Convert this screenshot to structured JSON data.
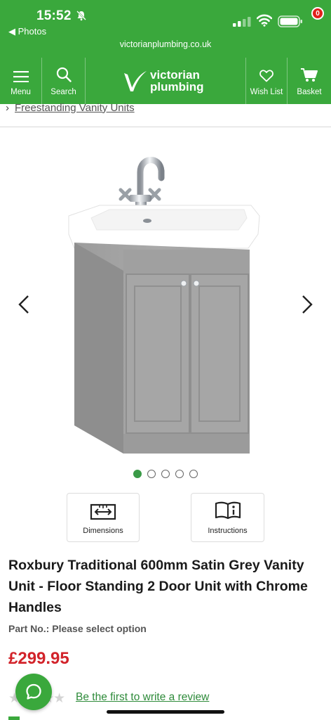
{
  "status_bar": {
    "time": "15:52",
    "back_label": "◀ Photos",
    "icons": [
      "bell-muted-icon",
      "signal-icon",
      "wifi-icon",
      "battery-icon"
    ]
  },
  "browser": {
    "url": "victorianplumbing.co.uk"
  },
  "header": {
    "menu_label": "Menu",
    "search_label": "Search",
    "logo_line1": "victorian",
    "logo_line2": "plumbing",
    "wishlist_label": "Wish List",
    "basket_label": "Basket",
    "basket_count": "0",
    "brand_color": "#3aa83c"
  },
  "breadcrumb": {
    "label": "Freestanding Vanity Units"
  },
  "gallery": {
    "image_count": 5,
    "active_index": 0
  },
  "docs": {
    "dimensions_label": "Dimensions",
    "instructions_label": "Instructions"
  },
  "product": {
    "title": "Roxbury Traditional 600mm Satin Grey Vanity Unit - Floor Standing 2 Door Unit with Chrome Handles",
    "part_no": "Part No.: Please select option",
    "price": "£299.95",
    "price_color": "#d2232a",
    "review_stars": "★★★★★",
    "review_link": "Be the first to write a review"
  }
}
